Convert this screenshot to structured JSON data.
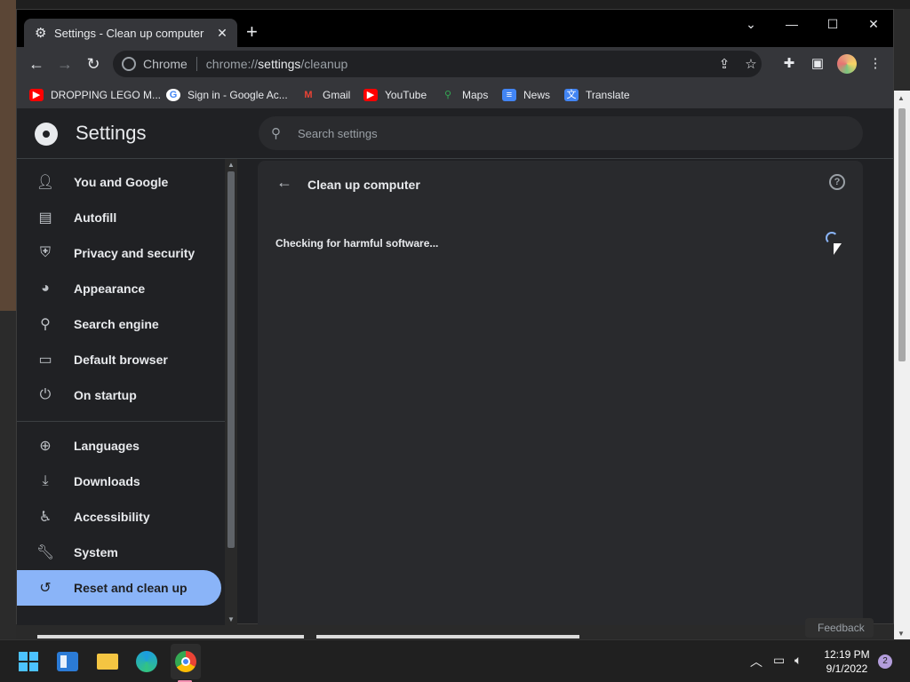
{
  "tab": {
    "title": "Settings - Clean up computer",
    "close": "✕",
    "new": "+"
  },
  "window_controls": {
    "dropdown": "⌄",
    "minimize": "—",
    "maximize": "☐",
    "close": "✕"
  },
  "omnibox": {
    "chrome_label": "Chrome",
    "url_prefix": "chrome://",
    "url_host": "settings",
    "url_path": "/cleanup"
  },
  "bookmarks": [
    {
      "label": "DROPPING LEGO M...",
      "icon": "youtube-icon"
    },
    {
      "label": "Sign in - Google Ac...",
      "icon": "google-icon"
    },
    {
      "label": "Gmail",
      "icon": "gmail-icon"
    },
    {
      "label": "YouTube",
      "icon": "youtube-icon"
    },
    {
      "label": "Maps",
      "icon": "maps-icon"
    },
    {
      "label": "News",
      "icon": "news-icon"
    },
    {
      "label": "Translate",
      "icon": "translate-icon"
    }
  ],
  "settings": {
    "title": "Settings",
    "search_placeholder": "Search settings"
  },
  "sidebar": {
    "items": [
      {
        "label": "You and Google",
        "icon": "person-icon"
      },
      {
        "label": "Autofill",
        "icon": "clipboard-icon"
      },
      {
        "label": "Privacy and security",
        "icon": "shield-icon"
      },
      {
        "label": "Appearance",
        "icon": "palette-icon"
      },
      {
        "label": "Search engine",
        "icon": "search-icon"
      },
      {
        "label": "Default browser",
        "icon": "browser-icon"
      },
      {
        "label": "On startup",
        "icon": "power-icon"
      },
      {
        "label": "Languages",
        "icon": "globe-icon"
      },
      {
        "label": "Downloads",
        "icon": "download-icon"
      },
      {
        "label": "Accessibility",
        "icon": "accessibility-icon"
      },
      {
        "label": "System",
        "icon": "wrench-icon"
      },
      {
        "label": "Reset and clean up",
        "icon": "history-icon"
      }
    ],
    "active_index": 11
  },
  "cleanup": {
    "title": "Clean up computer",
    "status": "Checking for harmful software..."
  },
  "feedback": "Feedback",
  "taskbar": {
    "time": "12:19 PM",
    "date": "9/1/2022",
    "notifications": "2"
  },
  "colors": {
    "accent": "#8ab4f8",
    "background": "#202124",
    "card": "#292a2d"
  }
}
